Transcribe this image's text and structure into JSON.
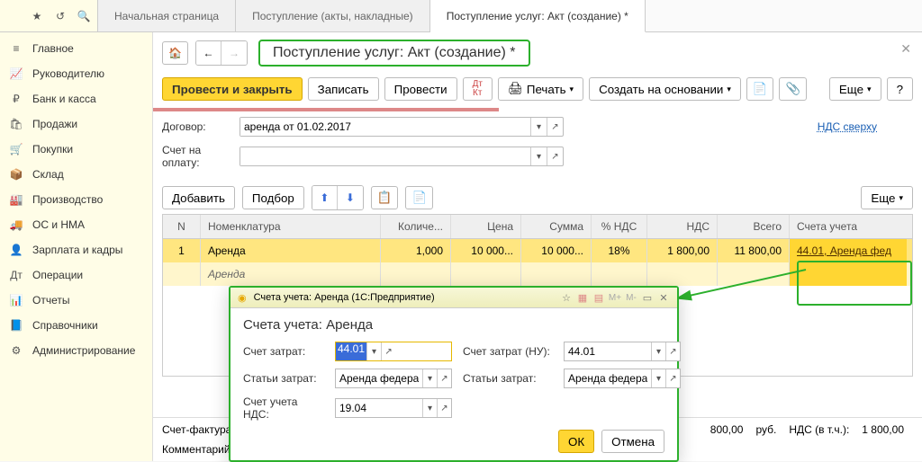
{
  "topbar": {
    "tabs": [
      {
        "label": "Начальная страница"
      },
      {
        "label": "Поступление (акты, накладные)"
      },
      {
        "label": "Поступление услуг: Акт (создание) *"
      }
    ]
  },
  "sidebar": [
    {
      "icon": "≡",
      "label": "Главное"
    },
    {
      "icon": "📈",
      "label": "Руководителю"
    },
    {
      "icon": "₽",
      "label": "Банк и касса"
    },
    {
      "icon": "🛍",
      "label": "Продажи"
    },
    {
      "icon": "🛒",
      "label": "Покупки"
    },
    {
      "icon": "📦",
      "label": "Склад"
    },
    {
      "icon": "🏭",
      "label": "Производство"
    },
    {
      "icon": "🚚",
      "label": "ОС и НМА"
    },
    {
      "icon": "👤",
      "label": "Зарплата и кадры"
    },
    {
      "icon": "Дт",
      "label": "Операции"
    },
    {
      "icon": "📊",
      "label": "Отчеты"
    },
    {
      "icon": "📘",
      "label": "Справочники"
    },
    {
      "icon": "⚙",
      "label": "Администрирование"
    }
  ],
  "page": {
    "title": "Поступление услуг: Акт (создание) *"
  },
  "toolbar": {
    "post_close": "Провести и закрыть",
    "save": "Записать",
    "post": "Провести",
    "print": "Печать",
    "create_based": "Создать на основании",
    "more": "Еще"
  },
  "form": {
    "contract_label": "Договор:",
    "contract_value": "аренда от 01.02.2017",
    "invoice_label": "Счет на оплату:",
    "invoice_value": "",
    "vat_link": "НДС сверху"
  },
  "table_toolbar": {
    "add": "Добавить",
    "select": "Подбор",
    "more": "Еще"
  },
  "table": {
    "headers": {
      "n": "N",
      "nom": "Номенклатура",
      "qty": "Количе...",
      "price": "Цена",
      "sum": "Сумма",
      "vatp": "% НДС",
      "vat": "НДС",
      "total": "Всего",
      "acc": "Счета учета"
    },
    "row": {
      "n": "1",
      "nom": "Аренда",
      "nom_sub": "Аренда",
      "qty": "1,000",
      "price": "10 000...",
      "sum": "10 000...",
      "vatp": "18%",
      "vat": "1 800,00",
      "total": "11 800,00",
      "acc": "44.01, Аренда фед"
    }
  },
  "footer": {
    "invoice_label": "Счет-фактура",
    "comment_label": "Комментарий",
    "total_amount": "800,00",
    "currency": "руб.",
    "vat_label": "НДС (в т.ч.):",
    "vat_amount": "1 800,00"
  },
  "dialog": {
    "window_title": "Счета учета: Аренда   (1С:Предприятие)",
    "heading": "Счета учета: Аренда",
    "cost_account_label": "Счет затрат:",
    "cost_account_value": "44.01",
    "cost_item_label": "Статьи затрат:",
    "cost_item_value": "Аренда федерал",
    "cost_account_nu_label": "Счет затрат (НУ):",
    "cost_account_nu_value": "44.01",
    "cost_item2_label": "Статьи затрат:",
    "cost_item2_value": "Аренда федерал",
    "vat_account_label": "Счет учета НДС:",
    "vat_account_value": "19.04",
    "ok": "ОК",
    "cancel": "Отмена"
  }
}
